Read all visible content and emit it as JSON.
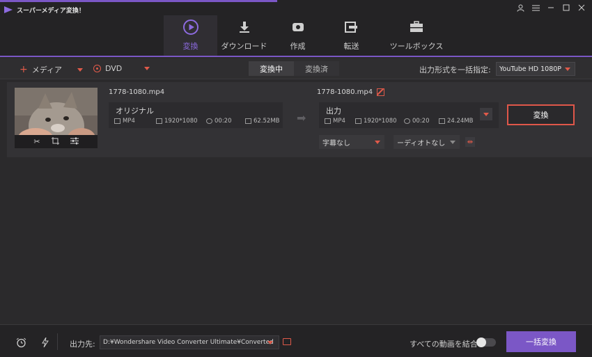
{
  "window": {
    "title": "スーパーメディア変換！",
    "accent": "#7b57c6",
    "highlight": "#e05a4a"
  },
  "nav": {
    "tabs": [
      {
        "label": "変換",
        "icon": "convert-icon",
        "active": true
      },
      {
        "label": "ダウンロード",
        "icon": "download-icon",
        "active": false
      },
      {
        "label": "作成",
        "icon": "burn-icon",
        "active": false
      },
      {
        "label": "転送",
        "icon": "transfer-icon",
        "active": false
      },
      {
        "label": "ツールボックス",
        "icon": "toolbox-icon",
        "active": false
      }
    ]
  },
  "toolbar": {
    "add_media": "メディア",
    "dvd": "DVD",
    "tab_converting": "変換中",
    "tab_converted": "変換済",
    "output_format_label": "出力形式を一括指定:",
    "output_format_value": "YouTube HD 1080P"
  },
  "item": {
    "source": {
      "filename": "1778-1080.mp4",
      "title": "オリジナル",
      "format": "MP4",
      "resolution": "1920*1080",
      "duration": "00:20",
      "size": "62.52MB"
    },
    "output": {
      "filename": "1778-1080.mp4",
      "title": "出力",
      "format": "MP4",
      "resolution": "1920*1080",
      "duration": "00:20",
      "size": "24.24MB"
    },
    "convert_label": "変換",
    "subtitle_value": "字幕なし",
    "audio_value": "ーディオトなし"
  },
  "bottom": {
    "dest_label": "出力先:",
    "dest_path": "D:¥Wondershare Video Converter Ultimate¥Converted",
    "merge_label": "すべての動画を結合",
    "batch_label": "一括変換"
  }
}
